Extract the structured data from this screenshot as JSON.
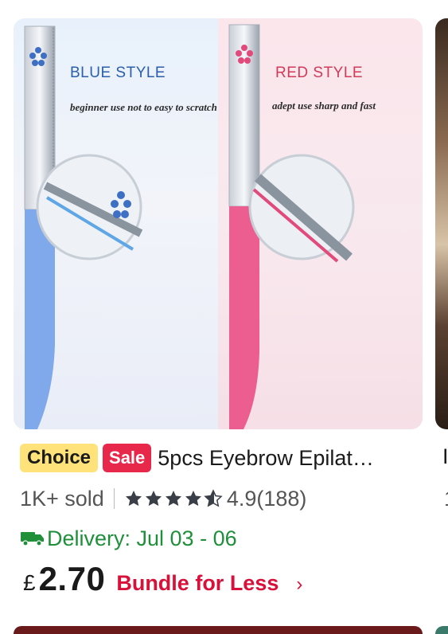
{
  "product": {
    "image": {
      "left_label": "BLUE STYLE",
      "left_caption": "beginner use not to easy to scratch",
      "right_label": "RED STYLE",
      "right_caption": "adept use sharp and fast",
      "colors": {
        "blue_label": "#2a5fae",
        "red_label": "#d23a5a",
        "blue_handle": "#7fa9ea",
        "pink_handle": "#ec5d90"
      }
    },
    "badges": {
      "choice": "Choice",
      "sale": "Sale"
    },
    "title": "5pcs Eyebrow Epilat…",
    "sold": "1K+ sold",
    "rating": "4.9",
    "review_count": "(188)",
    "stars_filled": 4.5,
    "delivery": "Delivery: Jul 03 - 06",
    "currency": "£",
    "price": "2.70",
    "bundle": "Bundle for Less",
    "chevron": "›",
    "colors": {
      "choice_bg": "#ffe27a",
      "sale_bg": "#e8284a",
      "delivery": "#1f8f3a",
      "bundle": "#d8103a"
    }
  },
  "next_product": {
    "title_peek": "I",
    "sold_peek": "1"
  }
}
